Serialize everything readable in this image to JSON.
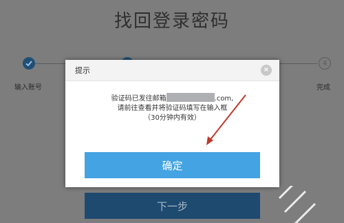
{
  "page": {
    "title": "找回登录密码",
    "next_label": "下一步"
  },
  "steps": [
    {
      "number": "",
      "label": "输入账号",
      "state": "done"
    },
    {
      "number": "",
      "label": "",
      "state": "done"
    },
    {
      "number": "",
      "label": "",
      "state": "pending"
    },
    {
      "number": "4",
      "label": "完成",
      "state": "pending"
    }
  ],
  "dialog": {
    "title": "提示",
    "close_symbol": "×",
    "line1_prefix": "验证码已发往邮箱",
    "line1_suffix": ".com,",
    "line2": "请前往查看并将验证码填写在输入框",
    "line3": "（30分钟内有效）",
    "confirm_label": "确定"
  },
  "colors": {
    "confirm_button": "#44a3e2",
    "next_button": "#1f4a70",
    "arrow": "#c0392b"
  }
}
